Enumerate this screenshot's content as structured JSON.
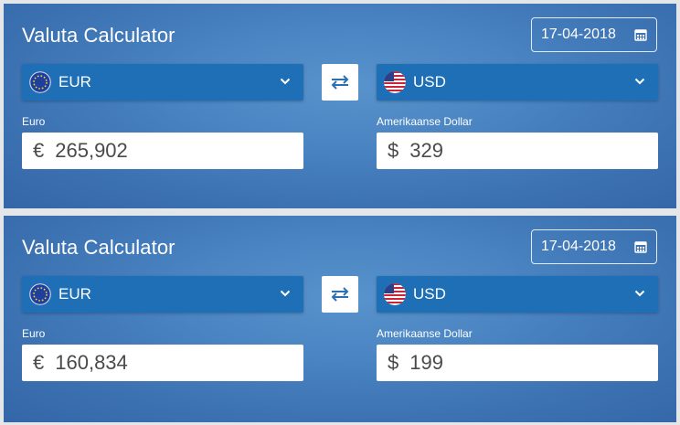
{
  "calculators": [
    {
      "title": "Valuta Calculator",
      "date": "17-04-2018",
      "from": {
        "code": "EUR",
        "name": "Euro",
        "symbol": "€",
        "amount": "265,902"
      },
      "to": {
        "code": "USD",
        "name": "Amerikaanse Dollar",
        "symbol": "$",
        "amount": "329"
      }
    },
    {
      "title": "Valuta Calculator",
      "date": "17-04-2018",
      "from": {
        "code": "EUR",
        "name": "Euro",
        "symbol": "€",
        "amount": "160,834"
      },
      "to": {
        "code": "USD",
        "name": "Amerikaanse Dollar",
        "symbol": "$",
        "amount": "199"
      }
    }
  ],
  "icons": {
    "date": "calendar-icon",
    "swap": "swap-arrows-icon",
    "dropdown": "chevron-down-icon",
    "eur_flag": "eu-flag-icon",
    "usd_flag": "us-flag-icon"
  },
  "colors": {
    "panel": "#4a84c2",
    "select": "#1f6fb6",
    "swap_arrows": "#2a6fb8"
  }
}
